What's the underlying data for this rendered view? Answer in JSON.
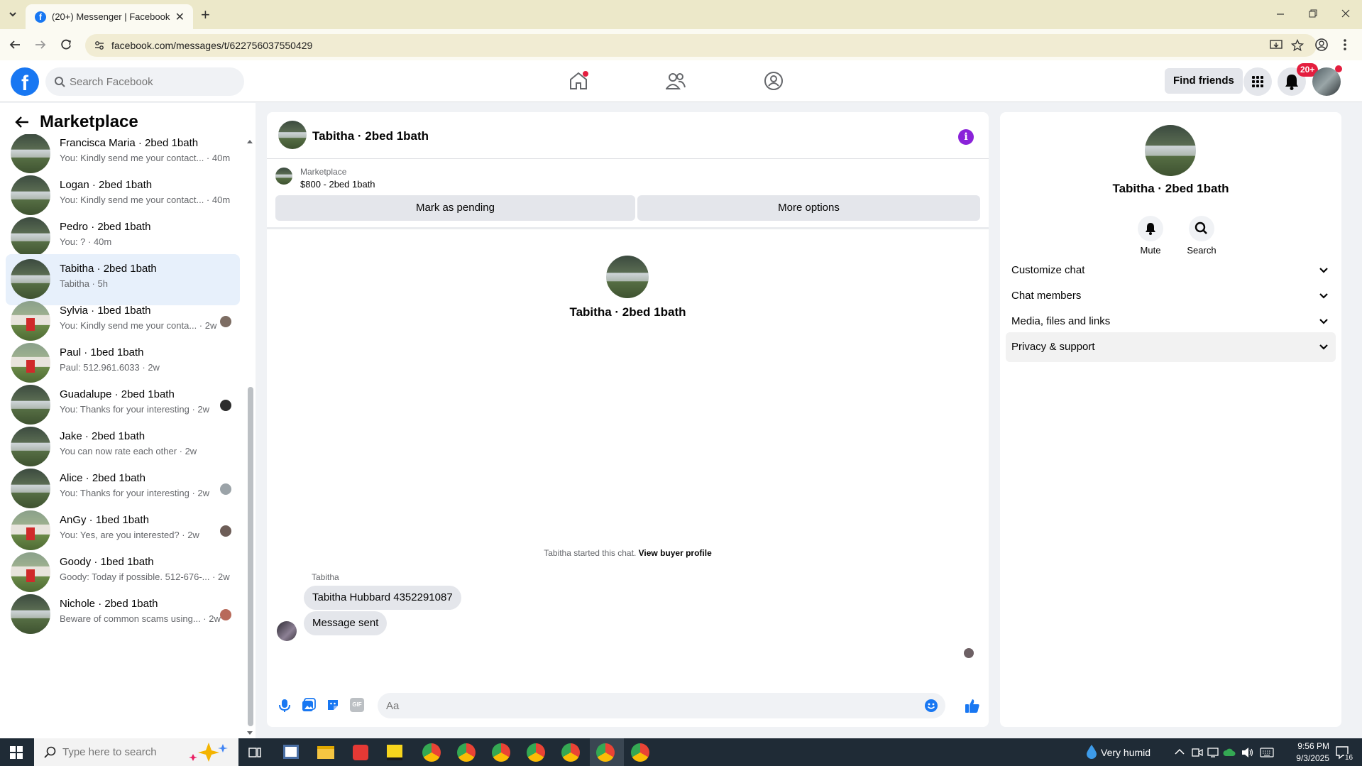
{
  "browser": {
    "tab_title": "(20+) Messenger | Facebook",
    "url": "facebook.com/messages/t/622756037550429"
  },
  "fb_nav": {
    "search_placeholder": "Search Facebook",
    "find_friends": "Find friends",
    "notification_badge": "20+"
  },
  "sidebar": {
    "title": "Marketplace",
    "conversations": [
      {
        "name": "Francisca Maria · 2bed 1bath",
        "snippet": "You: Kindly send me your contact... · 40m",
        "avatar": "house"
      },
      {
        "name": "Logan · 2bed 1bath",
        "snippet": "You: Kindly send me your contact... · 40m",
        "avatar": "house"
      },
      {
        "name": "Pedro · 2bed 1bath",
        "snippet": "You: ? · 40m",
        "avatar": "house"
      },
      {
        "name": "Tabitha · 2bed 1bath",
        "snippet": "Tabitha · 5h",
        "avatar": "house",
        "active": true
      },
      {
        "name": "Sylvia · 1bed 1bath",
        "snippet": "You: Kindly send me your conta... · 2w",
        "avatar": "red-door"
      },
      {
        "name": "Paul · 1bed 1bath",
        "snippet": "Paul: 512.961.6033 · 2w",
        "avatar": "red-door"
      },
      {
        "name": "Guadalupe · 2bed 1bath",
        "snippet": "You: Thanks for your interesting · 2w",
        "avatar": "house"
      },
      {
        "name": "Jake · 2bed 1bath",
        "snippet": "You can now rate each other · 2w",
        "avatar": "house"
      },
      {
        "name": "Alice · 2bed 1bath",
        "snippet": "You: Thanks for your interesting · 2w",
        "avatar": "house"
      },
      {
        "name": "AnGy · 1bed 1bath",
        "snippet": "You: Yes, are you interested? · 2w",
        "avatar": "red-door"
      },
      {
        "name": "Goody · 1bed 1bath",
        "snippet": "Goody: Today if possible. 512-676-... · 2w",
        "avatar": "red-door"
      },
      {
        "name": "Nichole · 2bed 1bath",
        "snippet": "Beware of common scams using... · 2w",
        "avatar": "house"
      }
    ]
  },
  "chat": {
    "title": "Tabitha · 2bed 1bath",
    "marketplace_label": "Marketplace",
    "listing": "$800 - 2bed 1bath",
    "mark_pending": "Mark as pending",
    "more_options": "More options",
    "profile_name": "Tabitha · 2bed 1bath",
    "started_text": "Tabitha started this chat.",
    "view_profile": "View buyer profile",
    "sender": "Tabitha",
    "messages": [
      "Tabitha Hubbard 4352291087",
      "Message sent"
    ],
    "composer_placeholder": "Aa"
  },
  "details": {
    "name": "Tabitha · 2bed 1bath",
    "mute": "Mute",
    "search": "Search",
    "sections": [
      "Customize chat",
      "Chat members",
      "Media, files and links",
      "Privacy & support"
    ]
  },
  "taskbar": {
    "search_placeholder": "Type here to search",
    "weather": "Very humid",
    "time": "9:56 PM",
    "date": "9/3/2025",
    "notification_count": "16"
  },
  "colors": {
    "facebook_blue": "#1877f2",
    "info_purple": "#8a22d9",
    "badge_red": "#e41e3f"
  }
}
